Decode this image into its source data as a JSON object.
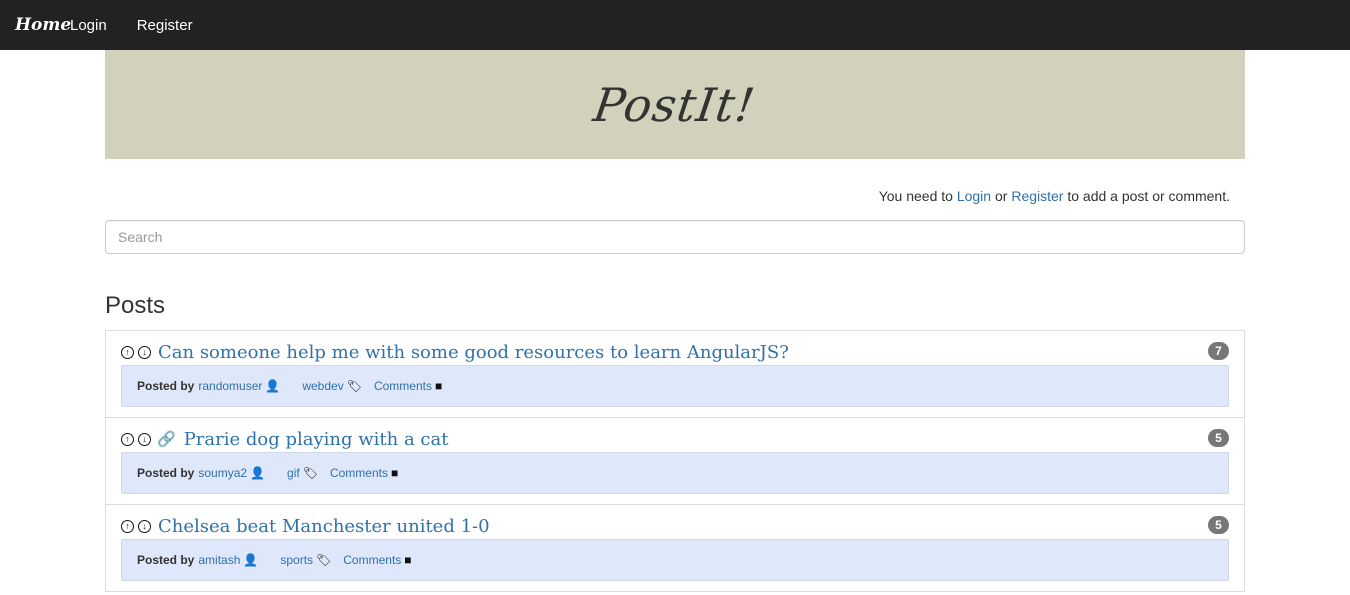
{
  "navbar": {
    "brand": "Home",
    "links": [
      "Login",
      "Register"
    ]
  },
  "banner": {
    "title": "PostIt!"
  },
  "notice": {
    "prefix": "You need to ",
    "login": "Login",
    "or": " or ",
    "register": "Register",
    "suffix": " to add a post or comment."
  },
  "search": {
    "placeholder": "Search",
    "value": ""
  },
  "posts_heading": "Posts",
  "posts": [
    {
      "title": "Can someone help me with some good resources to learn AngularJS?",
      "has_link": false,
      "count": "7",
      "posted_by_label": "Posted by",
      "author": "randomuser",
      "tag": "webdev",
      "comments_label": "Comments"
    },
    {
      "title": "Prarie dog playing with a cat",
      "has_link": true,
      "count": "5",
      "posted_by_label": "Posted by",
      "author": "soumya2",
      "tag": "gif",
      "comments_label": "Comments"
    },
    {
      "title": "Chelsea beat Manchester united 1-0",
      "has_link": false,
      "count": "5",
      "posted_by_label": "Posted by",
      "author": "amitash",
      "tag": "sports",
      "comments_label": "Comments"
    }
  ],
  "icons": {
    "upvote": "arrow-up-circle-icon",
    "downvote": "arrow-down-circle-icon",
    "link": "link-icon",
    "user": "user-icon",
    "tag": "tag-icon",
    "comment": "comment-icon"
  },
  "colors": {
    "navbar": "#222222",
    "banner": "#d2d2bc",
    "link": "#3071a9",
    "meta_bg": "#dfe8fa",
    "badge": "#777777"
  }
}
